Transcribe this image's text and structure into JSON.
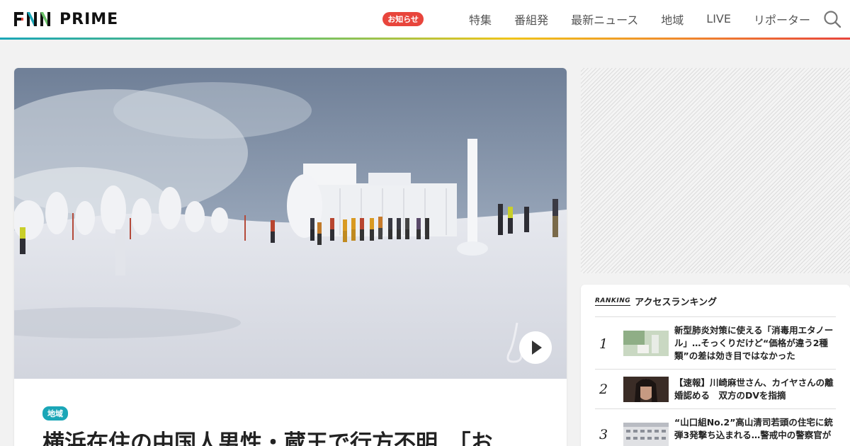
{
  "header": {
    "logo_text": "PRIME",
    "notice_label": "お知らせ",
    "nav": [
      "特集",
      "番組発",
      "最新ニュース",
      "地域",
      "LIVE",
      "リポーター"
    ],
    "search_icon": "search-icon"
  },
  "article": {
    "region_badge": "地域",
    "headline": "横浜在住の中国人男性・蔵王で行方不明　「お",
    "play_icon": "play-icon"
  },
  "ranking": {
    "logo": "RANKING",
    "title": "アクセスランキング",
    "items": [
      {
        "rank": "1",
        "text": "新型肺炎対策に使える「消毒用エタノール」…そっくりだけど“価格が違う2種類”の差は効き目ではなかった"
      },
      {
        "rank": "2",
        "text": "【速報】川崎麻世さん、カイヤさんの離婚認める　双方のDVを指摘"
      },
      {
        "rank": "3",
        "text": "“山口組No.2”高山清司若頭の住宅に銃弾3発撃ち込まれる…警戒中の警察官が"
      }
    ]
  },
  "colors": {
    "accent_red": "#e8453c",
    "accent_teal": "#1aa6b7"
  }
}
